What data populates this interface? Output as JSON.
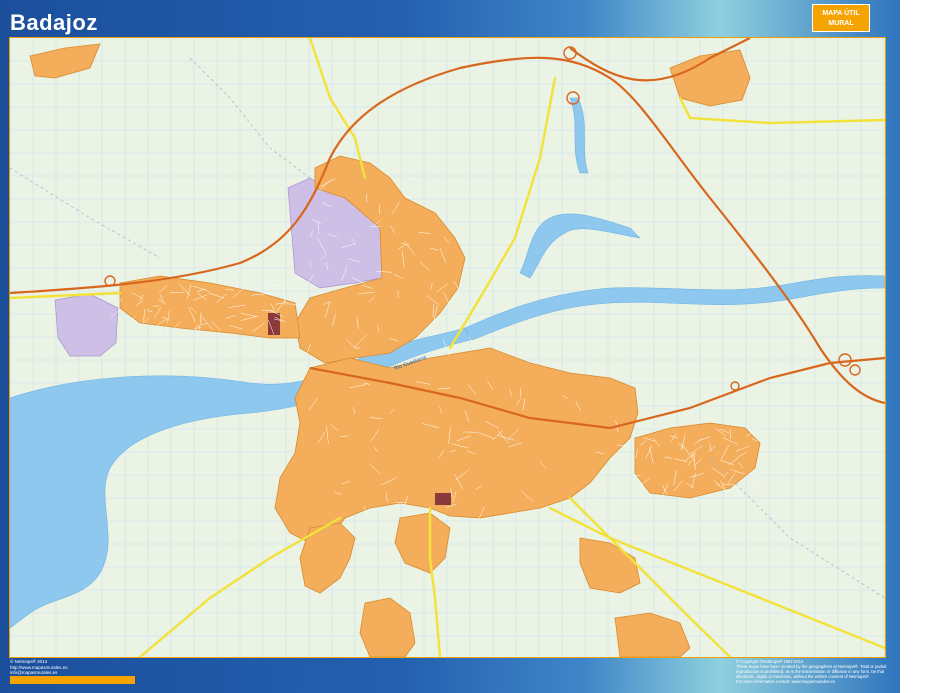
{
  "map": {
    "title": "Badajoz",
    "badge_line1": "MAPA ÚTIL",
    "badge_line2": "MURAL",
    "river_label": "Río Guadiana",
    "colors": {
      "frame": "#1b4f9c",
      "accent": "#f4a300",
      "urban": "#f4ae5b",
      "urban_outline": "#d98a2a",
      "industrial": "#cdbfe6",
      "river": "#8ec8ef",
      "highway": "#d9661d",
      "main_road": "#f2e23a",
      "background": "#eaf3e4",
      "grid": "#c9dff0"
    }
  },
  "footer": {
    "left_lines": [
      "© Netmaps® 2014",
      "http://www.mapasmurales.es",
      "info@mapasmurales.es"
    ],
    "right_lines": [
      "© Copyright ©Netmaps® 1997-2014",
      "These maps have been created by the geographers at Netmaps®. Total or partial",
      "reproduction is prohibited, as is the transmission or diffusion in any form, be that",
      "electronic, digital or mechanic, without the written consent of Netmaps®.",
      "For more information consult: www.mapasmurales.es"
    ]
  }
}
